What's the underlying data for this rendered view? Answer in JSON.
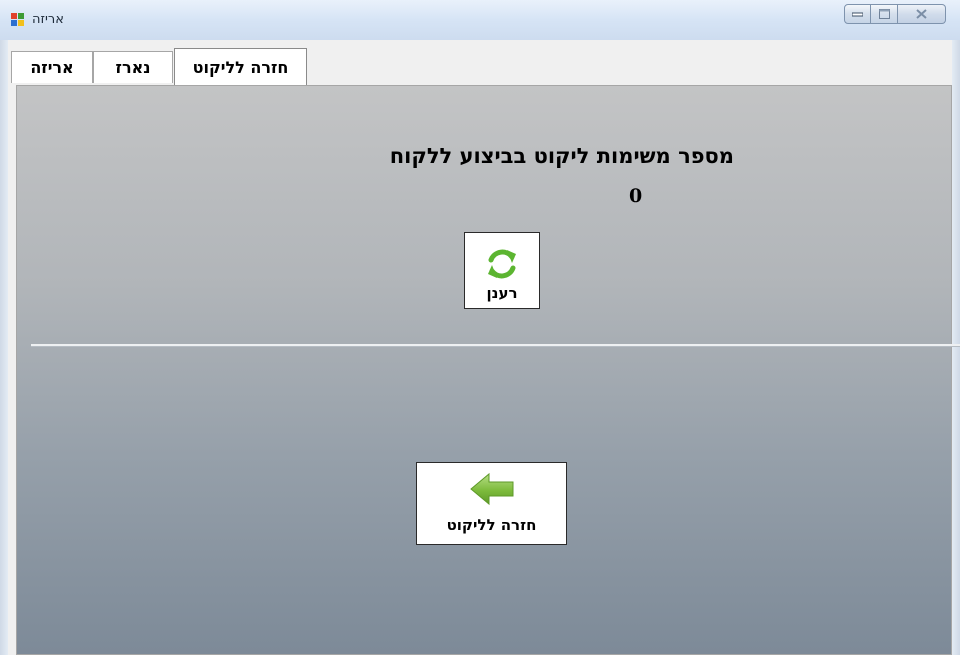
{
  "window": {
    "title": "אריזה"
  },
  "tabs": [
    {
      "label": "אריזה",
      "active": false
    },
    {
      "label": "נארז",
      "active": false
    },
    {
      "label": "חזרה לליקוט",
      "active": true
    }
  ],
  "content": {
    "heading": "מספר משימות ליקוט בביצוע ללקוח",
    "count": "0",
    "refresh_button": {
      "label": "רענן",
      "icon": "refresh-icon"
    },
    "back_button": {
      "label": "חזרה לליקוט",
      "icon": "arrow-left-icon"
    }
  },
  "colors": {
    "refresh_green": "#5cb531",
    "arrow_green": "#7dbb3c",
    "panel_top": "#c3c4c5",
    "panel_bottom": "#7d8a98"
  }
}
